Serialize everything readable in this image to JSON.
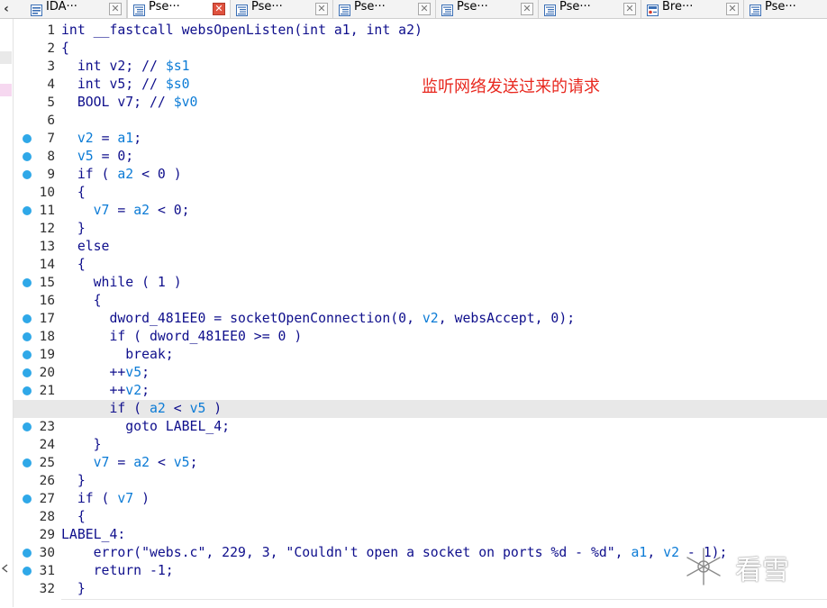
{
  "tabs": [
    {
      "label": "IDA···",
      "icon": "ida-view-icon",
      "active": false
    },
    {
      "label": "Pse···",
      "icon": "pseudocode-icon",
      "active": true
    },
    {
      "label": "Pse···",
      "icon": "pseudocode-icon",
      "active": false
    },
    {
      "label": "Pse···",
      "icon": "pseudocode-icon",
      "active": false
    },
    {
      "label": "Pse···",
      "icon": "pseudocode-icon",
      "active": false
    },
    {
      "label": "Pse···",
      "icon": "pseudocode-icon",
      "active": false
    },
    {
      "label": "Bre···",
      "icon": "breakpoints-icon",
      "active": false
    },
    {
      "label": "Pse···",
      "icon": "pseudocode-icon",
      "active": false
    }
  ],
  "tab_close_glyph": "✕",
  "nav_left_glyph": "‹",
  "annotation": "监听网络发送过来的请求",
  "watermark": "看雪",
  "colors": {
    "keyword": "#0f0f8c",
    "variable": "#0b7bd6",
    "breakpoint": "#2fa8e8",
    "annotation": "#e8281f",
    "highlight_row": "#e8e8e8"
  },
  "highlighted_line": 22,
  "lines": [
    {
      "num": "1",
      "bp": false,
      "tokens": [
        [
          "k",
          "int __fastcall websOpenListen(int a1, int a2)"
        ]
      ]
    },
    {
      "num": "2",
      "bp": false,
      "tokens": [
        [
          "k",
          "{"
        ]
      ]
    },
    {
      "num": "3",
      "bp": false,
      "tokens": [
        [
          "k",
          "  int v2; // "
        ],
        [
          "c",
          "$s1"
        ]
      ]
    },
    {
      "num": "4",
      "bp": false,
      "tokens": [
        [
          "k",
          "  int v5; // "
        ],
        [
          "c",
          "$s0"
        ]
      ]
    },
    {
      "num": "5",
      "bp": false,
      "tokens": [
        [
          "k",
          "  BOOL v7; // "
        ],
        [
          "c",
          "$v0"
        ]
      ]
    },
    {
      "num": "6",
      "bp": false,
      "tokens": [
        [
          "k",
          ""
        ]
      ]
    },
    {
      "num": "7",
      "bp": true,
      "tokens": [
        [
          "k",
          "  "
        ],
        [
          "v",
          "v2"
        ],
        [
          "k",
          " = "
        ],
        [
          "v",
          "a1"
        ],
        [
          "k",
          ";"
        ]
      ]
    },
    {
      "num": "8",
      "bp": true,
      "tokens": [
        [
          "k",
          "  "
        ],
        [
          "v",
          "v5"
        ],
        [
          "k",
          " = 0;"
        ]
      ]
    },
    {
      "num": "9",
      "bp": true,
      "tokens": [
        [
          "k",
          "  if ( "
        ],
        [
          "v",
          "a2"
        ],
        [
          "k",
          " < 0 )"
        ]
      ]
    },
    {
      "num": "10",
      "bp": false,
      "tokens": [
        [
          "k",
          "  {"
        ]
      ]
    },
    {
      "num": "11",
      "bp": true,
      "tokens": [
        [
          "k",
          "    "
        ],
        [
          "v",
          "v7"
        ],
        [
          "k",
          " = "
        ],
        [
          "v",
          "a2"
        ],
        [
          "k",
          " < 0;"
        ]
      ]
    },
    {
      "num": "12",
      "bp": false,
      "tokens": [
        [
          "k",
          "  }"
        ]
      ]
    },
    {
      "num": "13",
      "bp": false,
      "tokens": [
        [
          "k",
          "  else"
        ]
      ]
    },
    {
      "num": "14",
      "bp": false,
      "tokens": [
        [
          "k",
          "  {"
        ]
      ]
    },
    {
      "num": "15",
      "bp": true,
      "tokens": [
        [
          "k",
          "    while ( 1 )"
        ]
      ]
    },
    {
      "num": "16",
      "bp": false,
      "tokens": [
        [
          "k",
          "    {"
        ]
      ]
    },
    {
      "num": "17",
      "bp": true,
      "tokens": [
        [
          "k",
          "      dword_481EE0 = socketOpenConnection(0, "
        ],
        [
          "v",
          "v2"
        ],
        [
          "k",
          ", websAccept, 0);"
        ]
      ]
    },
    {
      "num": "18",
      "bp": true,
      "tokens": [
        [
          "k",
          "      if ( dword_481EE0 >= 0 )"
        ]
      ]
    },
    {
      "num": "19",
      "bp": true,
      "tokens": [
        [
          "k",
          "        break;"
        ]
      ]
    },
    {
      "num": "20",
      "bp": true,
      "tokens": [
        [
          "k",
          "      ++"
        ],
        [
          "v",
          "v5"
        ],
        [
          "k",
          ";"
        ]
      ]
    },
    {
      "num": "21",
      "bp": true,
      "tokens": [
        [
          "k",
          "      ++"
        ],
        [
          "v",
          "v2"
        ],
        [
          "k",
          ";"
        ]
      ]
    },
    {
      "num": "22",
      "bp": true,
      "tokens": [
        [
          "k",
          "      if ( "
        ],
        [
          "v",
          "a2"
        ],
        [
          "k",
          " < "
        ],
        [
          "v",
          "v5"
        ],
        [
          "k",
          " )"
        ]
      ]
    },
    {
      "num": "23",
      "bp": true,
      "tokens": [
        [
          "k",
          "        goto LABEL_4;"
        ]
      ]
    },
    {
      "num": "24",
      "bp": false,
      "tokens": [
        [
          "k",
          "    }"
        ]
      ]
    },
    {
      "num": "25",
      "bp": true,
      "tokens": [
        [
          "k",
          "    "
        ],
        [
          "v",
          "v7"
        ],
        [
          "k",
          " = "
        ],
        [
          "v",
          "a2"
        ],
        [
          "k",
          " < "
        ],
        [
          "v",
          "v5"
        ],
        [
          "k",
          ";"
        ]
      ]
    },
    {
      "num": "26",
      "bp": false,
      "tokens": [
        [
          "k",
          "  }"
        ]
      ]
    },
    {
      "num": "27",
      "bp": true,
      "tokens": [
        [
          "k",
          "  if ( "
        ],
        [
          "v",
          "v7"
        ],
        [
          "k",
          " )"
        ]
      ]
    },
    {
      "num": "28",
      "bp": false,
      "tokens": [
        [
          "k",
          "  {"
        ]
      ]
    },
    {
      "num": "29",
      "bp": false,
      "tokens": [
        [
          "k",
          "LABEL_4:"
        ]
      ]
    },
    {
      "num": "30",
      "bp": true,
      "tokens": [
        [
          "k",
          "    error(\"webs.c\", 229, 3, \"Couldn't open a socket on ports %d - %d\", "
        ],
        [
          "v",
          "a1"
        ],
        [
          "k",
          ", "
        ],
        [
          "v",
          "v2"
        ],
        [
          "k",
          " - 1);"
        ]
      ]
    },
    {
      "num": "31",
      "bp": true,
      "tokens": [
        [
          "k",
          "    return -1;"
        ]
      ]
    },
    {
      "num": "32",
      "bp": false,
      "tokens": [
        [
          "k",
          "  }"
        ]
      ]
    }
  ]
}
